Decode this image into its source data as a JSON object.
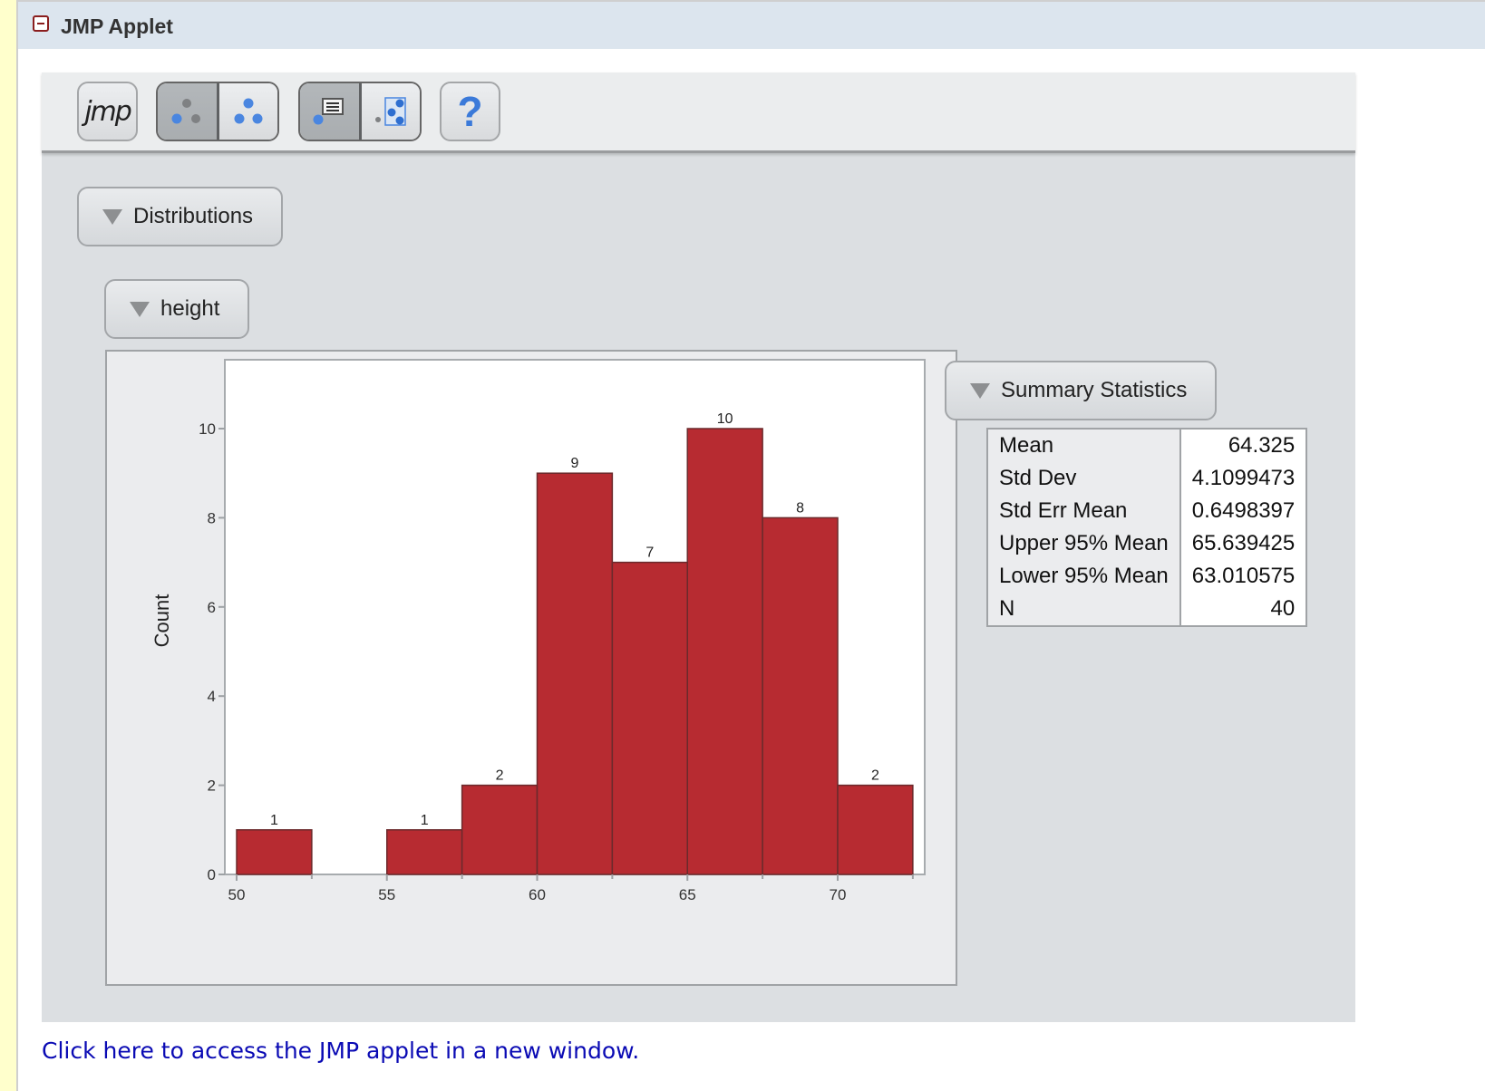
{
  "header": {
    "title": "JMP Applet",
    "collapse_icon": "minus-box-icon"
  },
  "toolbar": {
    "logo_text": "jmp",
    "buttons": [
      {
        "name": "jmp-logo",
        "icon": "jmp-logo-icon"
      },
      {
        "name": "points-gray",
        "icon": "scatter-gray-points-icon",
        "selected": true
      },
      {
        "name": "points-blue",
        "icon": "scatter-blue-points-icon",
        "selected": false
      },
      {
        "name": "point-label",
        "icon": "point-label-icon",
        "selected": true
      },
      {
        "name": "point-select",
        "icon": "point-select-box-icon",
        "selected": false
      },
      {
        "name": "help",
        "icon": "help-icon"
      }
    ],
    "help_glyph": "?"
  },
  "outline": {
    "distributions_label": "Distributions",
    "variable_label": "height",
    "summary_label": "Summary Statistics"
  },
  "colors": {
    "bar_fill": "#b72b31",
    "bar_stroke": "#6b2a2c",
    "link": "#0a0ab4",
    "header_bg": "#dce5ee"
  },
  "chart_data": {
    "type": "bar",
    "title": "",
    "xlabel": "",
    "ylabel": "Count",
    "bins": [
      {
        "from": 50,
        "to": 52.5,
        "count": 1
      },
      {
        "from": 52.5,
        "to": 55,
        "count": 0
      },
      {
        "from": 55,
        "to": 57.5,
        "count": 1
      },
      {
        "from": 57.5,
        "to": 60,
        "count": 2
      },
      {
        "from": 60,
        "to": 62.5,
        "count": 9
      },
      {
        "from": 62.5,
        "to": 65,
        "count": 7
      },
      {
        "from": 65,
        "to": 67.5,
        "count": 10
      },
      {
        "from": 67.5,
        "to": 70,
        "count": 8
      },
      {
        "from": 70,
        "to": 72.5,
        "count": 2
      }
    ],
    "xlim": [
      49.6,
      72.9
    ],
    "ylim": [
      0,
      11.5
    ],
    "xticks": [
      50,
      55,
      60,
      65,
      70
    ],
    "xminor_ticks": [
      52.5,
      57.5,
      62.5,
      67.5,
      72.5
    ],
    "yticks": [
      0,
      2,
      4,
      6,
      8,
      10
    ],
    "data_labels": true,
    "grid": false,
    "legend": "none"
  },
  "summary_statistics": [
    {
      "label": "Mean",
      "value": "64.325"
    },
    {
      "label": "Std Dev",
      "value": "4.1099473"
    },
    {
      "label": "Std Err Mean",
      "value": "0.6498397"
    },
    {
      "label": "Upper 95% Mean",
      "value": "65.639425"
    },
    {
      "label": "Lower 95% Mean",
      "value": "63.010575"
    },
    {
      "label": "N",
      "value": "40"
    }
  ],
  "footer": {
    "link_text": "Click here to access the JMP applet in a new window."
  }
}
